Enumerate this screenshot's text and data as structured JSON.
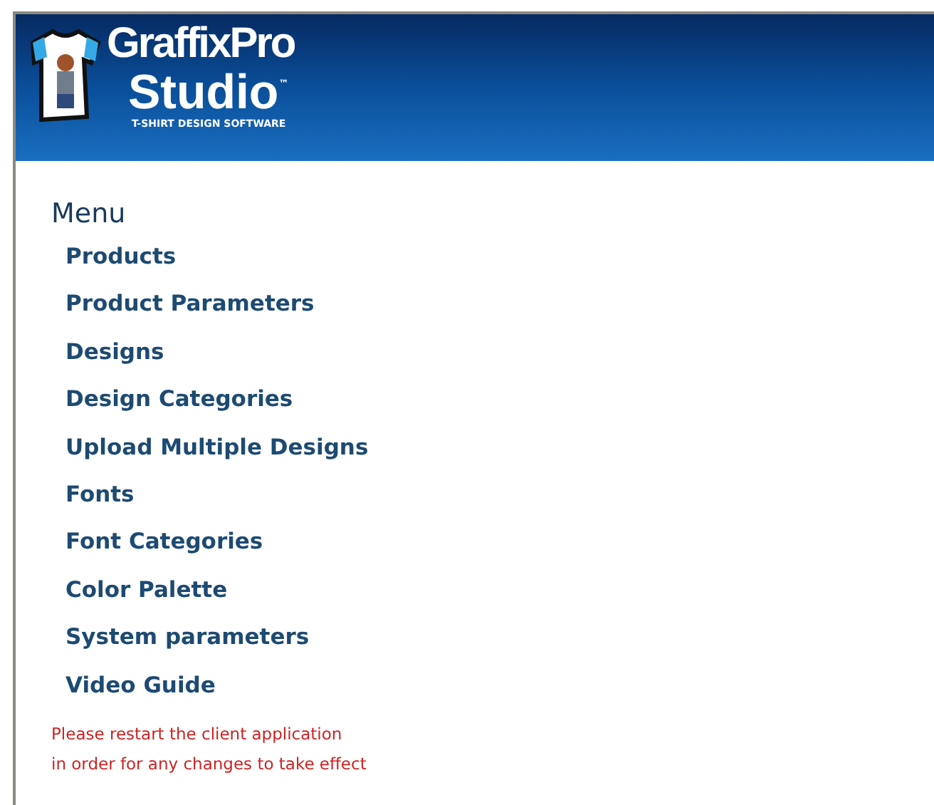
{
  "header": {
    "logo_line_1": "GraffixPro",
    "logo_line_2": "Studio",
    "trademark": "™",
    "tagline": "T-SHIRT DESIGN SOFTWARE"
  },
  "menu": {
    "title": "Menu",
    "items": [
      {
        "label": "Products"
      },
      {
        "label": "Product Parameters"
      },
      {
        "label": "Designs"
      },
      {
        "label": "Design Categories"
      },
      {
        "label": "Upload Multiple Designs"
      },
      {
        "label": "Fonts"
      },
      {
        "label": "Font Categories"
      },
      {
        "label": "Color Palette"
      },
      {
        "label": "System parameters"
      },
      {
        "label": "Video Guide"
      }
    ]
  },
  "notice": [
    "Please restart the client application",
    "in order for any changes to take effect"
  ]
}
